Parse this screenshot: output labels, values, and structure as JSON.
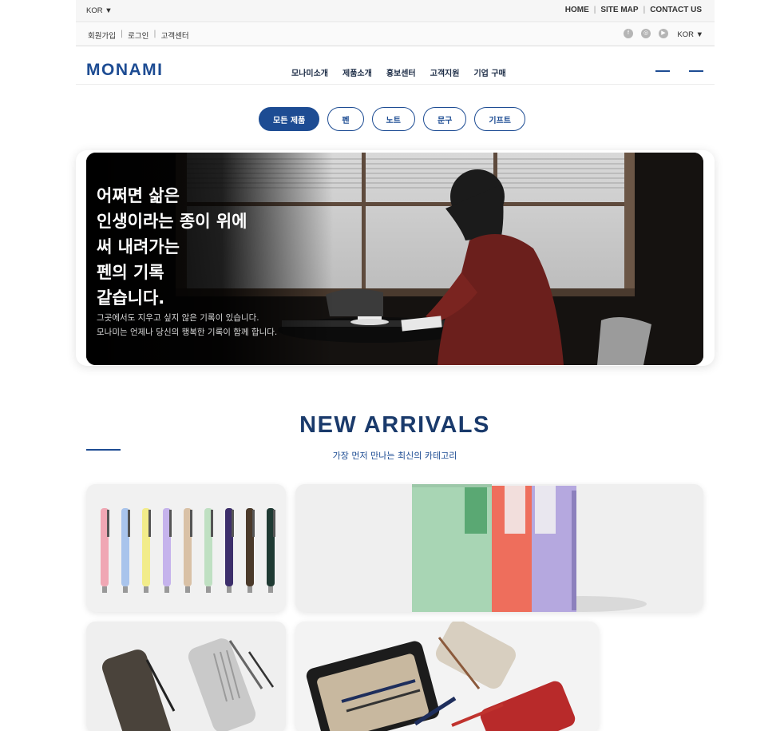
{
  "topbar": {
    "language": "KOR ▼",
    "links": [
      "HOME",
      "SITE MAP",
      "CONTACT US"
    ]
  },
  "subbar": {
    "auth_links": [
      "회원가입",
      "로그인",
      "고객센터"
    ],
    "social_icons": [
      "facebook-icon",
      "instagram-icon",
      "youtube-icon"
    ],
    "language": "KOR ▼"
  },
  "nav": {
    "logo": "MONAMI",
    "menu": [
      "모나미소개",
      "제품소개",
      "홍보센터",
      "고객지원",
      "기업 구매"
    ]
  },
  "filters": {
    "items": [
      "모든 제품",
      "펜",
      "노트",
      "문구",
      "기프트"
    ],
    "active": "모든 제품"
  },
  "hero": {
    "headline": "어쩌면 삶은\n인생이라는 종이 위에\n써 내려가는\n펜의 기록\n같습니다.",
    "subtext": "   그곳에서도 지우고 싶지 않은 기록이 있습니다.\n모나미는 언제나 당신의 행복한 기록이 함께 합니다."
  },
  "new_arrivals": {
    "title": "NEW ARRIVALS",
    "subtitle": "가장 먼저 만나는 최신의 카테고리"
  },
  "colors": {
    "brand": "#1d4c93",
    "title": "#1a3a6b"
  }
}
